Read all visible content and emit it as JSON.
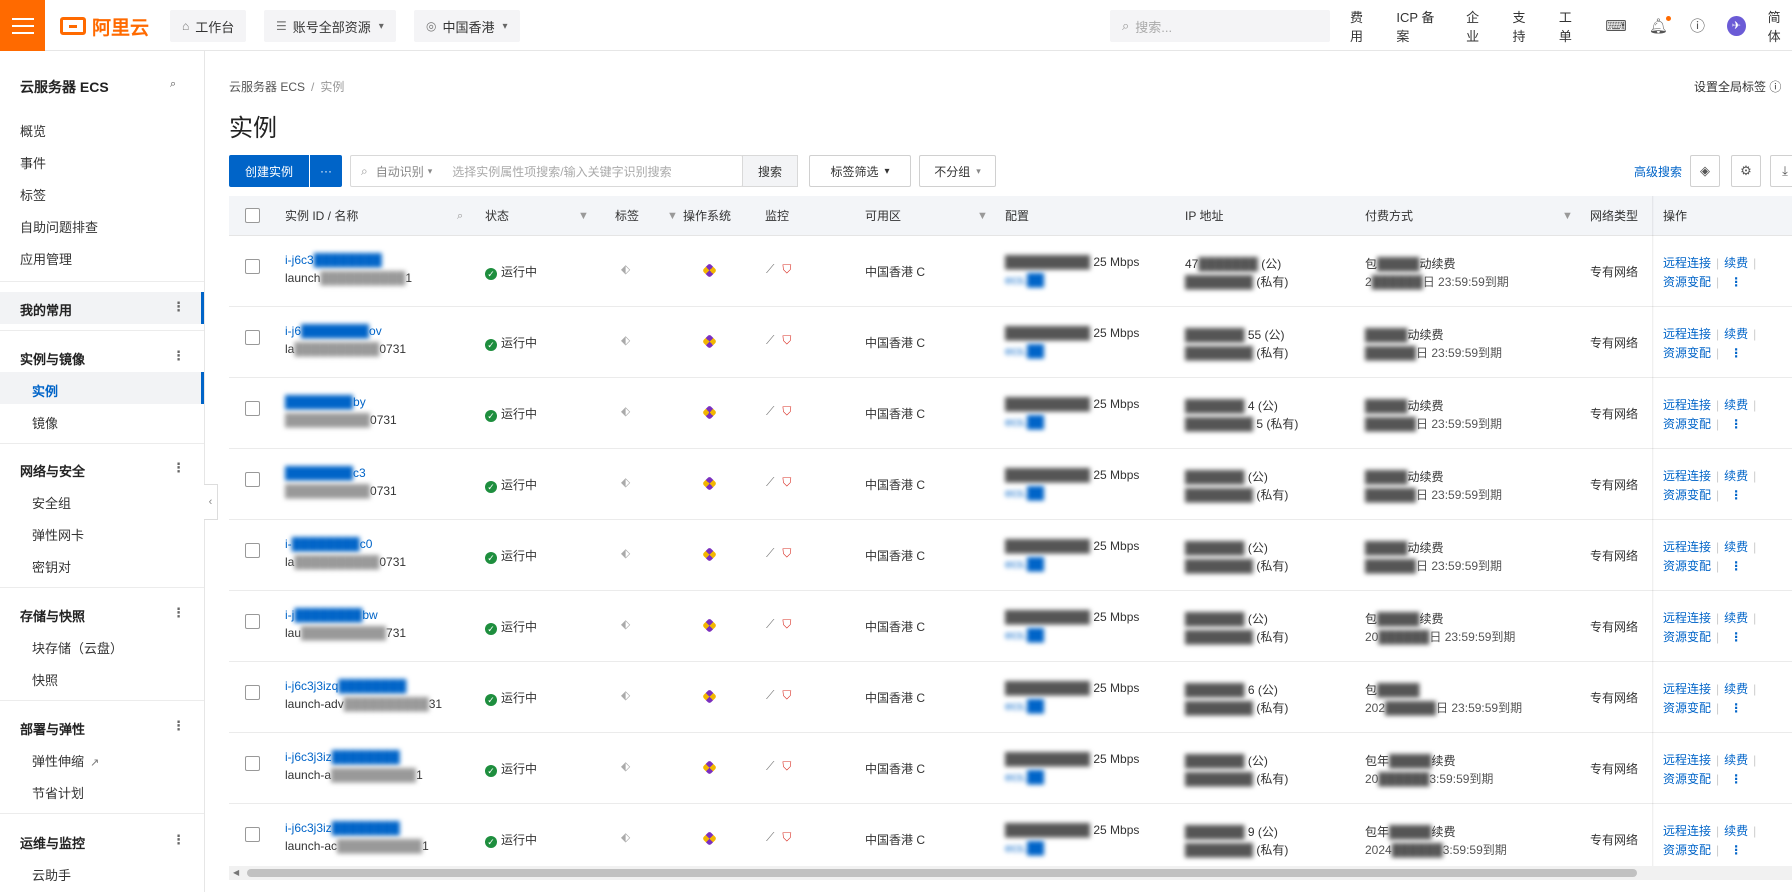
{
  "topbar": {
    "logo_text": "阿里云",
    "workbench": "工作台",
    "resource_group": "账号全部资源",
    "region": "中国香港",
    "search_placeholder": "搜索...",
    "links": [
      "费用",
      "ICP 备案",
      "企业",
      "支持",
      "工单"
    ],
    "lang": "简体",
    "avatar_letter": "✈"
  },
  "sidebar": {
    "title": "云服务器 ECS",
    "top_items": [
      "概览",
      "事件",
      "标签",
      "自助问题排查",
      "应用管理"
    ],
    "favorites": "我的常用",
    "group_instances": "实例与镜像",
    "item_instances": "实例",
    "item_images": "镜像",
    "group_network": "网络与安全",
    "net_items": [
      "安全组",
      "弹性网卡",
      "密钥对"
    ],
    "group_storage": "存储与快照",
    "storage_items": [
      "块存储（云盘）",
      "快照"
    ],
    "group_deploy": "部署与弹性",
    "deploy_items": [
      "弹性伸缩",
      "节省计划"
    ],
    "group_ops": "运维与监控",
    "ops_items": [
      "云助手"
    ],
    "more": "⋮"
  },
  "main": {
    "breadcrumb_root": "云服务器 ECS",
    "breadcrumb_sep": "/",
    "breadcrumb_current": "实例",
    "global_tag": "设置全局标签",
    "title": "实例",
    "create_button": "创建实例",
    "more_button": "···",
    "search_mode": "自动识别",
    "search_placeholder": "选择实例属性项搜索/输入关键字识别搜索",
    "search_button": "搜索",
    "tag_filter": "标签筛选",
    "group_filter": "不分组",
    "advanced_search": "高级搜索"
  },
  "table": {
    "headers": {
      "id": "实例 ID / 名称",
      "status": "状态",
      "tag": "标签",
      "os": "操作系统",
      "monitor": "监控",
      "zone": "可用区",
      "config": "配置",
      "ip": "IP 地址",
      "billing": "付费方式",
      "network": "网络类型",
      "ops": "操作"
    },
    "rows": [
      {
        "id": "i-j6c3",
        "name": "launch",
        "id_tail": "",
        "name_tail": "1",
        "status": "运行中",
        "zone": "中国香港 C",
        "bandwidth": "25 Mbps",
        "ip_pub": "47",
        "ip_pub_suffix": "(公)",
        "ip_priv_suffix": "(私有)",
        "bill1": "包",
        "bill1_tail": "动续费",
        "bill2": "2",
        "bill2_tail": "日 23:59:59到期",
        "network": "专有网络",
        "op_remote": "远程连接",
        "op_renew": "续费",
        "op_change": "资源变配"
      },
      {
        "id": "i-j6",
        "name": "la",
        "id_tail": "ov",
        "name_tail": "0731",
        "status": "运行中",
        "zone": "中国香港 C",
        "bandwidth": "25 Mbps",
        "ip_pub": "",
        "ip_pub_suffix": "55 (公)",
        "ip_priv_suffix": "(私有)",
        "bill1": "",
        "bill1_tail": "动续费",
        "bill2": "",
        "bill2_tail": "日 23:59:59到期",
        "network": "专有网络",
        "op_remote": "远程连接",
        "op_renew": "续费",
        "op_change": "资源变配"
      },
      {
        "id": "",
        "name": "",
        "id_tail": "by",
        "name_tail": "0731",
        "status": "运行中",
        "zone": "中国香港 C",
        "bandwidth": "25 Mbps",
        "ip_pub": "",
        "ip_pub_suffix": "4 (公)",
        "ip_priv_suffix": "5 (私有)",
        "bill1": "",
        "bill1_tail": "动续费",
        "bill2": "",
        "bill2_tail": "日 23:59:59到期",
        "network": "专有网络",
        "op_remote": "远程连接",
        "op_renew": "续费",
        "op_change": "资源变配"
      },
      {
        "id": "",
        "name": "",
        "id_tail": "c3",
        "name_tail": "0731",
        "status": "运行中",
        "zone": "中国香港 C",
        "bandwidth": "25 Mbps",
        "ip_pub": "",
        "ip_pub_suffix": "(公)",
        "ip_priv_suffix": "(私有)",
        "bill1": "",
        "bill1_tail": "动续费",
        "bill2": "",
        "bill2_tail": "日 23:59:59到期",
        "network": "专有网络",
        "op_remote": "远程连接",
        "op_renew": "续费",
        "op_change": "资源变配"
      },
      {
        "id": "i-",
        "name": "la",
        "id_tail": "c0",
        "name_tail": "0731",
        "status": "运行中",
        "zone": "中国香港 C",
        "bandwidth": "25 Mbps",
        "ip_pub": "",
        "ip_pub_suffix": "(公)",
        "ip_priv_suffix": "(私有)",
        "bill1": "",
        "bill1_tail": "动续费",
        "bill2": "",
        "bill2_tail": "日 23:59:59到期",
        "network": "专有网络",
        "op_remote": "远程连接",
        "op_renew": "续费",
        "op_change": "资源变配"
      },
      {
        "id": "i-j",
        "name": "lau",
        "id_tail": "bw",
        "name_tail": "731",
        "status": "运行中",
        "zone": "中国香港 C",
        "bandwidth": "25 Mbps",
        "ip_pub": "",
        "ip_pub_suffix": "(公)",
        "ip_priv_suffix": "(私有)",
        "bill1": "包",
        "bill1_tail": "续费",
        "bill2": "20",
        "bill2_tail": "日 23:59:59到期",
        "network": "专有网络",
        "op_remote": "远程连接",
        "op_renew": "续费",
        "op_change": "资源变配"
      },
      {
        "id": "i-j6c3j3izq",
        "name": "launch-adv",
        "id_tail": "",
        "name_tail": "31",
        "status": "运行中",
        "zone": "中国香港 C",
        "bandwidth": "25 Mbps",
        "ip_pub": "",
        "ip_pub_suffix": "6 (公)",
        "ip_priv_suffix": "(私有)",
        "bill1": "包",
        "bill1_tail": "",
        "bill2": "202",
        "bill2_tail": "日 23:59:59到期",
        "network": "专有网络",
        "op_remote": "远程连接",
        "op_renew": "续费",
        "op_change": "资源变配"
      },
      {
        "id": "i-j6c3j3iz",
        "name": "launch-a",
        "id_tail": "",
        "name_tail": "1",
        "status": "运行中",
        "zone": "中国香港 C",
        "bandwidth": "25 Mbps",
        "ip_pub": "",
        "ip_pub_suffix": "(公)",
        "ip_priv_suffix": "(私有)",
        "bill1": "包年",
        "bill1_tail": "续费",
        "bill2": "20",
        "bill2_tail": "3:59:59到期",
        "network": "专有网络",
        "op_remote": "远程连接",
        "op_renew": "续费",
        "op_change": "资源变配"
      },
      {
        "id": "i-j6c3j3iz",
        "name": "launch-ac",
        "id_tail": "",
        "name_tail": "1",
        "status": "运行中",
        "zone": "中国香港 C",
        "bandwidth": "25 Mbps",
        "ip_pub": "",
        "ip_pub_suffix": "9 (公)",
        "ip_priv_suffix": "(私有)",
        "bill1": "包年",
        "bill1_tail": "续费",
        "bill2": "2024",
        "bill2_tail": "3:59:59到期",
        "network": "专有网络",
        "op_remote": "远程连接",
        "op_renew": "续费",
        "op_change": "资源变配"
      }
    ]
  }
}
